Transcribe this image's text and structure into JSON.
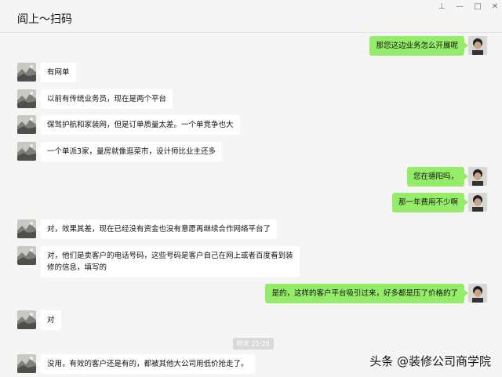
{
  "window": {
    "title": "阎上～扫码",
    "controls": {
      "pin": "⊥",
      "minimize": "—",
      "maximize": "□",
      "close": "✕"
    }
  },
  "colors": {
    "sent_bubble": "#95ec69",
    "received_bubble": "#ffffff",
    "background": "#f5f5f5"
  },
  "messages": [
    {
      "side": "right",
      "text": "那您这边业务怎么开展呢"
    },
    {
      "side": "left",
      "text": "有网单"
    },
    {
      "side": "left",
      "text": "以前有传统业务员，现在是两个平台"
    },
    {
      "side": "left",
      "text": "保驾护航和家装网，但是订单质量太差。一个单竞争也大"
    },
    {
      "side": "left",
      "text": "一个单派3家，量房就像逛菜市，设计师比业主还多"
    },
    {
      "side": "right",
      "text": "您在德阳吗，"
    },
    {
      "side": "right",
      "text": "那一年费用不少啊"
    },
    {
      "side": "left",
      "text": "对，效果其差，现在已经没有资金也没有意愿再继续合作网络平台了"
    },
    {
      "side": "left",
      "text": "对，他们是卖客户的电话号码，这些号码是客户自己在网上或者百度看到装修的信息，填写的"
    },
    {
      "side": "right",
      "text": "是的，这样的客户平台吸引过来，好多都是压了价格的了"
    },
    {
      "side": "left",
      "text": "对"
    },
    {
      "side": "left",
      "text": "没用，有效的客户还是有的，都被其他大公司用低价抢走了。"
    }
  ],
  "timestamp": "昨天 21:20",
  "watermark": "头条 @装修公司商学院"
}
